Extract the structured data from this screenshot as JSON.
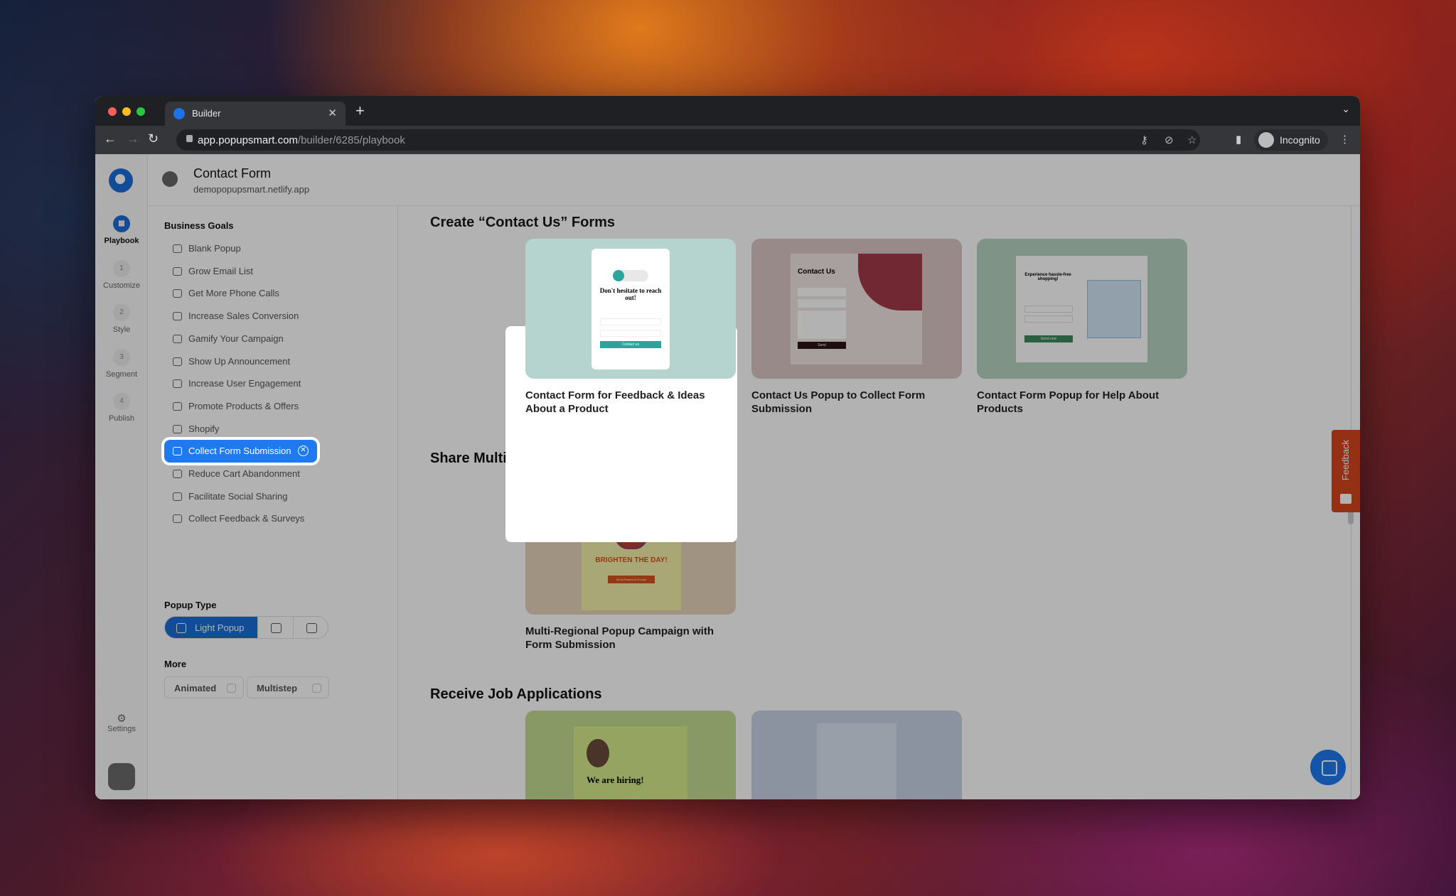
{
  "browser": {
    "tab_title": "Builder",
    "url_host": "app.popupsmart.com",
    "url_path": "/builder/6285/playbook",
    "profile": "Incognito"
  },
  "header": {
    "title": "Contact Form",
    "subtitle": "demopopupsmart.netlify.app"
  },
  "rail": {
    "steps": [
      {
        "num": "",
        "label": "Playbook"
      },
      {
        "num": "1",
        "label": "Customize"
      },
      {
        "num": "2",
        "label": "Style"
      },
      {
        "num": "3",
        "label": "Segment"
      },
      {
        "num": "4",
        "label": "Publish"
      }
    ],
    "settings": "Settings"
  },
  "sidebar": {
    "business_goals_title": "Business Goals",
    "items": [
      {
        "label": "Blank Popup",
        "icon": "blank-popup-icon"
      },
      {
        "label": "Grow Email List",
        "icon": "envelope-icon"
      },
      {
        "label": "Get More Phone Calls",
        "icon": "headphones-icon"
      },
      {
        "label": "Increase Sales Conversion",
        "icon": "chart-icon"
      },
      {
        "label": "Gamify Your Campaign",
        "icon": "gamepad-icon"
      },
      {
        "label": "Show Up Announcement",
        "icon": "bell-icon"
      },
      {
        "label": "Increase User Engagement",
        "icon": "users-icon"
      },
      {
        "label": "Promote Products & Offers",
        "icon": "user-megaphone-icon"
      },
      {
        "label": "Shopify",
        "icon": "shopify-icon"
      },
      {
        "label": "Collect Form Submission",
        "icon": "form-icon",
        "active": true
      },
      {
        "label": "Reduce Cart Abandonment",
        "icon": "face-icon"
      },
      {
        "label": "Facilitate Social Sharing",
        "icon": "heart-icon"
      },
      {
        "label": "Collect Feedback & Surveys",
        "icon": "feedback-icon"
      }
    ],
    "popup_type_title": "Popup Type",
    "popup_type_selected": "Light Popup",
    "more_title": "More",
    "more_options": [
      {
        "label": "Animated",
        "checked": false
      },
      {
        "label": "Multistep",
        "checked": false
      }
    ]
  },
  "sections": [
    {
      "title": "Create “Contact Us” Forms",
      "cards": [
        {
          "title": "Contact Form for Feedback & Ideas About a Product",
          "bg": "#b5d3cf",
          "preview": {
            "heading": "Don't hesitate to reach out!",
            "button": "Contact us"
          }
        },
        {
          "title": "Contact Us Popup to Collect Form Submission",
          "bg": "#d9c3c3",
          "preview": {
            "heading": "Contact Us",
            "button": "Send"
          }
        },
        {
          "title": "Contact Form Popup for Help About Products",
          "bg": "#b6d4c2",
          "preview": {
            "heading": "Experience hassle-free shopping!",
            "button": "Send now"
          }
        }
      ]
    },
    {
      "title": "Share Multi-Regional News",
      "cards": [
        {
          "title": "Multi-Regional Popup Campaign with Form Submission",
          "bg": "#e5d3ba",
          "preview": {
            "heading": "BRIGHTEN THE DAY!",
            "button": "Send Flowers to Europe"
          }
        }
      ]
    },
    {
      "title": "Receive Job Applications",
      "cards": [
        {
          "title": "",
          "bg": "#bfd98a",
          "preview": {
            "heading": "We are hiring!"
          }
        },
        {
          "title": "",
          "bg": "#c6d2e8",
          "preview": {}
        }
      ]
    }
  ],
  "feedback_tab": "Feedback",
  "colors": {
    "accent": "#1f7af0",
    "feedback": "#d4461c"
  }
}
